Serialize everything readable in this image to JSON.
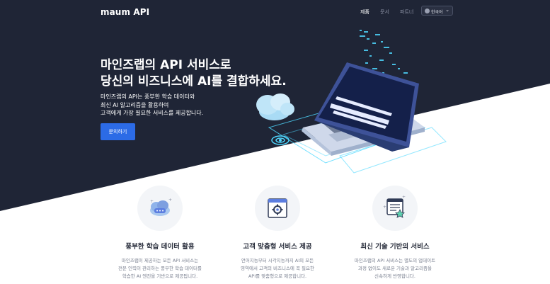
{
  "header": {
    "logo": "maum API",
    "nav": [
      {
        "label": "제품",
        "active": true
      },
      {
        "label": "문서",
        "active": false
      },
      {
        "label": "파트너",
        "active": false
      }
    ],
    "language": {
      "icon": "globe-icon",
      "label": "한국어",
      "chevron": "chevron-down-icon"
    }
  },
  "hero": {
    "title_lines": [
      "마인즈랩의 API 서비스로",
      "당신의 비즈니스에 AI를 결합하세요."
    ],
    "desc_lines": [
      "마인즈랩의 API는 풍부한 학습 데이터와",
      "최신 AI 알고리즘을 활용하여",
      "고객에게 가장 필요한 서비스를 제공합니다."
    ],
    "cta_label": "문의하기"
  },
  "features": [
    {
      "icon": "cloud-chat-icon",
      "title": "풍부한 학습 데이터 활용",
      "desc_lines": [
        "마인즈랩이 제공하는 모든 API 서비스는",
        "전문 인력이 관리하는 풍부한 학습 데이터를",
        "학습한 AI 엔진을 기반으로 제공됩니다."
      ]
    },
    {
      "icon": "gear-window-icon",
      "title": "고객 맞춤형 서비스 제공",
      "desc_lines": [
        "언어지능부터 시각지능까지 AI의 모든",
        "영역에서 고객의 비즈니스에 꼭 필요한",
        "API를 맞춤형으로 제공합니다."
      ]
    },
    {
      "icon": "badge-window-icon",
      "title": "최신 기술 기반의 서비스",
      "desc_lines": [
        "마인즈랩의 API 서비스는 별도의 업데이트",
        "과정 없이도 새로운 기술과 알고리즘을",
        "신속하게 반영합니다."
      ]
    }
  ],
  "colors": {
    "hero_bg": "#1f2536",
    "accent": "#2c6be6",
    "illustration_cyan": "#4fd8ff"
  }
}
